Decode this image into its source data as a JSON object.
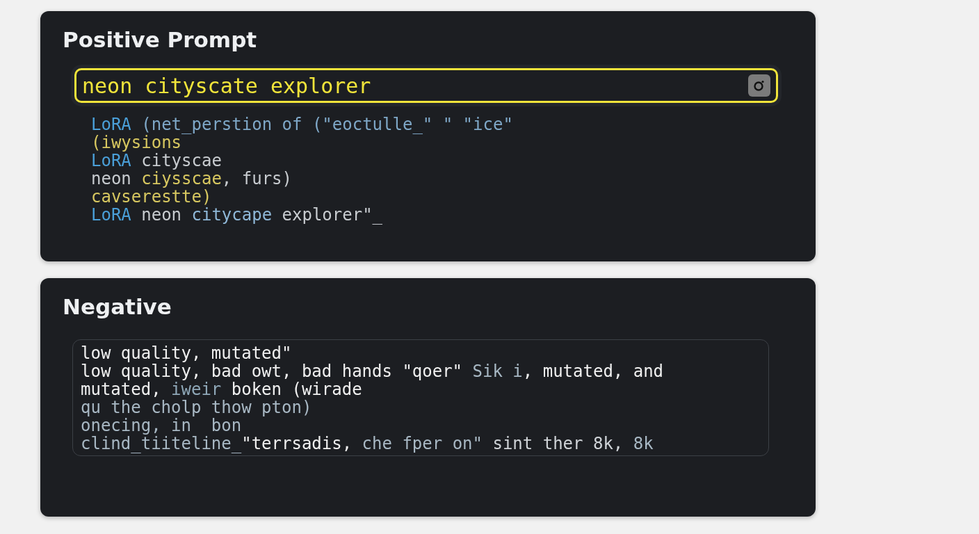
{
  "positive": {
    "title": "Positive Prompt",
    "input": {
      "value": "neon cityscate explorer",
      "focused": true
    },
    "lines": [
      [
        {
          "text": "LoRA",
          "color": "#4a9fd8"
        },
        {
          "text": " (net_perstion of (\"eoctulle_\" \" \"ice\"",
          "color": "#7fa8c8"
        }
      ],
      [
        {
          "text": "(iwysions",
          "color": "#d8c860"
        }
      ],
      [
        {
          "text": "LoRA",
          "color": "#4a9fd8"
        },
        {
          "text": " cityscae",
          "color": "#c8ccd0"
        }
      ],
      [
        {
          "text": "neon ",
          "color": "#c8ccd0"
        },
        {
          "text": "ciysscae",
          "color": "#d8c860"
        },
        {
          "text": ", furs)",
          "color": "#c8ccd0"
        }
      ],
      [
        {
          "text": "cavserestte)",
          "color": "#d8c860"
        }
      ],
      [
        {
          "text": "LoRA",
          "color": "#4a9fd8"
        },
        {
          "text": " neon ",
          "color": "#c8ccd0"
        },
        {
          "text": "citycape",
          "color": "#8fb8d8"
        },
        {
          "text": " explorer\"_",
          "color": "#c8ccd0"
        }
      ]
    ]
  },
  "negative": {
    "title": "Negative",
    "lines": [
      [
        {
          "text": "low quality, mutated\"",
          "color": "#f0f0f0"
        }
      ],
      [
        {
          "text": "low quality, bad owt, bad hands \"qoer\" ",
          "color": "#f0f0f0"
        },
        {
          "text": "Sik i",
          "color": "#a8b8c4"
        },
        {
          "text": ", mutated, and",
          "color": "#f0f0f0"
        }
      ],
      [
        {
          "text": "mutated, ",
          "color": "#f0f0f0"
        },
        {
          "text": "iweir",
          "color": "#8fa8b8"
        },
        {
          "text": " boken (wirade",
          "color": "#f0f0f0"
        }
      ],
      [
        {
          "text": "qu the cholp thow pton)",
          "color": "#a8b8c4"
        }
      ],
      [
        {
          "text": "onecing, in  bon",
          "color": "#a8b8c4"
        }
      ],
      [
        {
          "text": "clind_tiiteline_",
          "color": "#a8b8c4"
        },
        {
          "text": "\"terrsadis,",
          "color": "#f0f0f0"
        },
        {
          "text": " che fper on\"",
          "color": "#a8b8c4"
        },
        {
          "text": " sint ther 8k, ",
          "color": "#d0d4d8"
        },
        {
          "text": "8k",
          "color": "#a8b8c4"
        }
      ]
    ]
  }
}
